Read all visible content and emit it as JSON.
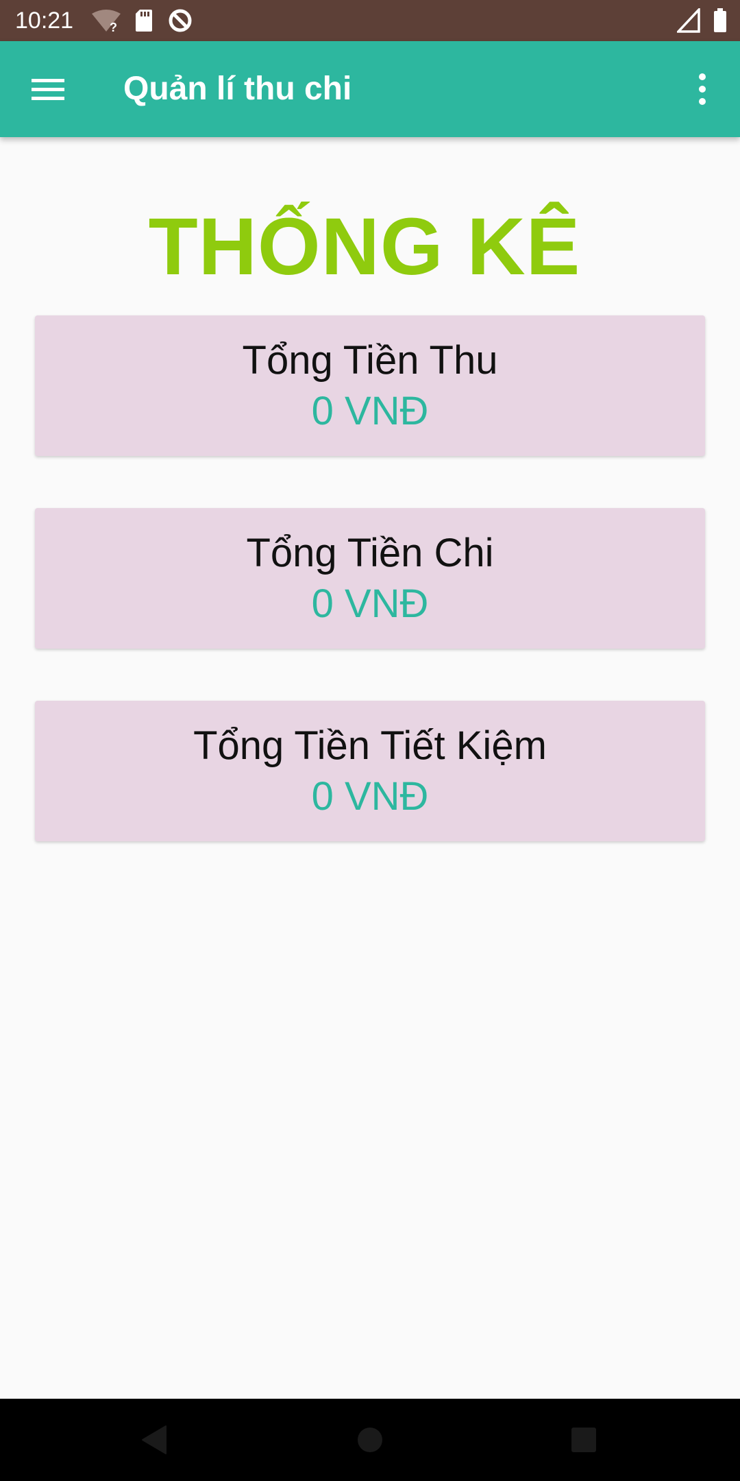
{
  "status_bar": {
    "time": "10:21",
    "icons": [
      "wifi-question-icon",
      "sd-card-icon",
      "data-saver-icon",
      "cell-signal-icon",
      "battery-icon"
    ]
  },
  "app_bar": {
    "title": "Quản lí thu chi",
    "background_color": "#2db79f",
    "icons": [
      "menu-icon",
      "more-vert-icon"
    ]
  },
  "page": {
    "title": "THỐNG KÊ",
    "title_color": "#8fcb0e"
  },
  "stats": [
    {
      "label": "Tổng Tiền Thu",
      "value": "0 VNĐ"
    },
    {
      "label": "Tổng Tiền Chi",
      "value": "0 VNĐ"
    },
    {
      "label": "Tổng Tiền Tiết Kiệm",
      "value": "0 VNĐ"
    }
  ],
  "card_color": "#e8d5e3",
  "value_color": "#2db79f",
  "nav_bar": {
    "icons": [
      "back-icon",
      "home-icon",
      "recents-icon"
    ]
  }
}
